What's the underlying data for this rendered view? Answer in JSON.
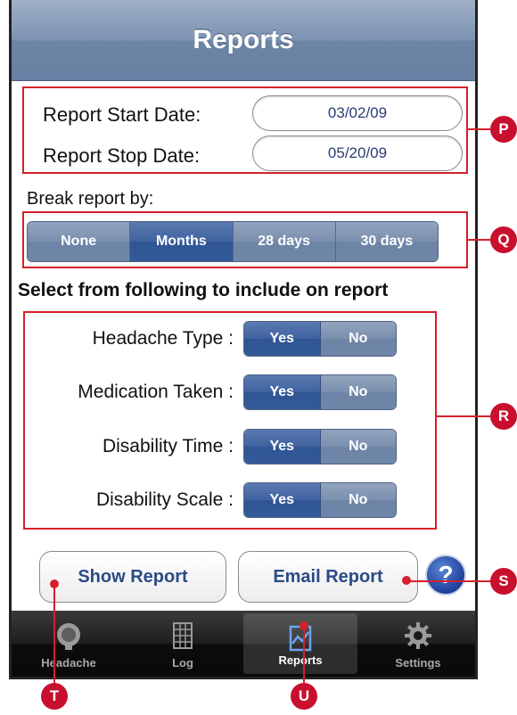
{
  "nav": {
    "title": "Reports"
  },
  "dates": {
    "start_label": "Report Start Date:",
    "start_value": "03/02/09",
    "stop_label": "Report Stop Date:",
    "stop_value": "05/20/09"
  },
  "break": {
    "label": "Break report by:",
    "options": [
      "None",
      "Months",
      "28 days",
      "30 days"
    ],
    "selected": "Months"
  },
  "include": {
    "heading": "Select from following to include on report",
    "items": [
      {
        "label": "Headache Type :",
        "yes": "Yes",
        "no": "No",
        "selected": "Yes"
      },
      {
        "label": "Medication Taken :",
        "yes": "Yes",
        "no": "No",
        "selected": "Yes"
      },
      {
        "label": "Disability Time :",
        "yes": "Yes",
        "no": "No",
        "selected": "Yes"
      },
      {
        "label": "Disability Scale :",
        "yes": "Yes",
        "no": "No",
        "selected": "Yes"
      }
    ]
  },
  "actions": {
    "show_label": "Show Report",
    "email_label": "Email Report",
    "help_label": "?"
  },
  "tabs": [
    {
      "label": "Headache",
      "icon": "head-icon"
    },
    {
      "label": "Log",
      "icon": "grid-icon"
    },
    {
      "label": "Reports",
      "icon": "chart-icon",
      "active": true
    },
    {
      "label": "Settings",
      "icon": "gear-icon"
    }
  ],
  "callouts": {
    "p": "P",
    "q": "Q",
    "r": "R",
    "s": "S",
    "t": "T",
    "u": "U"
  },
  "colors": {
    "callout_red": "#d4202a",
    "selected_blue": "#345a9a",
    "nav_blue": "#6d84a6"
  }
}
